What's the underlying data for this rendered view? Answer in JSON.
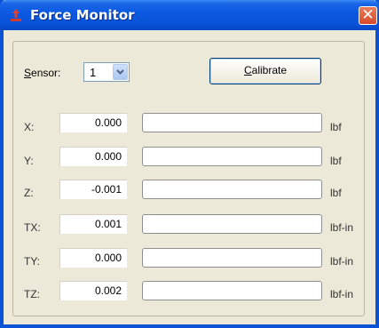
{
  "window": {
    "title": "Force Monitor"
  },
  "sensor": {
    "label_prefix": "S",
    "label_rest": "ensor:",
    "value": "1"
  },
  "calibrate": {
    "label_prefix": "C",
    "label_rest": "alibrate"
  },
  "rows": [
    {
      "label": "X:",
      "value": "0.000",
      "unit": "lbf"
    },
    {
      "label": "Y:",
      "value": "0.000",
      "unit": "lbf"
    },
    {
      "label": "Z:",
      "value": "-0.001",
      "unit": "lbf"
    },
    {
      "label": "TX:",
      "value": "0.001",
      "unit": "lbf-in"
    },
    {
      "label": "TY:",
      "value": "0.000",
      "unit": "lbf-in"
    },
    {
      "label": "TZ:",
      "value": "0.002",
      "unit": "lbf-in"
    }
  ],
  "icons": {
    "app": "force-arrow-icon",
    "close": "close-icon",
    "dropdown": "chevron-down-icon"
  }
}
